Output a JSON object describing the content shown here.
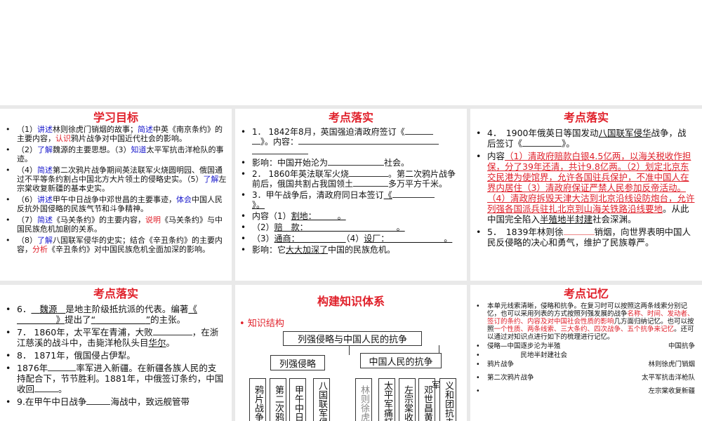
{
  "slides": [
    {
      "title": "学习目标",
      "items": [
        {
          "parts": [
            [
              "",
              "（1）"
            ],
            [
              "blue",
              "讲述"
            ],
            [
              "",
              "林则徐虎门销烟的故事；"
            ],
            [
              "blue",
              "简述"
            ],
            [
              "",
              "中英《南京条约》的主要内容，"
            ],
            [
              "red",
              "认识"
            ],
            [
              "",
              "鸦片战争对中国近代社会的影响。"
            ]
          ]
        },
        {
          "parts": [
            [
              "",
              "（2）"
            ],
            [
              "blue",
              "了解"
            ],
            [
              "",
              "魏源的主要思想。（3）"
            ],
            [
              "blue",
              "知道"
            ],
            [
              "",
              "太平军抗击洋枪队的事迹。"
            ]
          ]
        },
        {
          "parts": [
            [
              "",
              "（4）"
            ],
            [
              "blue",
              "简述"
            ],
            [
              "",
              "第二次鸦片战争期间英法联军火烧圆明园、俄国通过不平等条约割占中国北方大片领土的侵略史实。（5）"
            ],
            [
              "blue",
              "了解"
            ],
            [
              "",
              "左宗棠收复新疆的基本史实。"
            ]
          ]
        },
        {
          "parts": [
            [
              "",
              "（6）"
            ],
            [
              "blue",
              "讲述"
            ],
            [
              "",
              "甲午中日战争中邓世昌的主要事迹，"
            ],
            [
              "blue",
              "体会"
            ],
            [
              "",
              "中国人民反抗外国侵略的民族气节和斗争精神。"
            ]
          ]
        },
        {
          "parts": [
            [
              "",
              "（7）"
            ],
            [
              "blue",
              "简述"
            ],
            [
              "",
              "《马关条约》的主要内容，"
            ],
            [
              "red",
              "说明"
            ],
            [
              "",
              "《马关条约》与中国民族危机加剧的关系。"
            ]
          ]
        },
        {
          "parts": [
            [
              "",
              "（8）"
            ],
            [
              "blue",
              "了解"
            ],
            [
              "",
              "八国联军侵华的史实；结合《辛丑条约》的主要内容，"
            ],
            [
              "red",
              "分析"
            ],
            [
              "",
              "《辛丑条约》对中国民族危机全面加深的影响。"
            ]
          ]
        }
      ]
    },
    {
      "title": "考点落实",
      "items": {
        "i1a": "1． 1842年8月，英国强迫清政府签订《",
        "i1b": "》。内容：",
        "i2": "影响：中国开始沦为",
        "i2b": "社会。",
        "i3a": "2． 1860年英法联军火烧",
        "i3b": "。第二次鸦片战争前后，俄国共割占我国领土",
        "i3c": "多万平方千米。",
        "i4a": "3．甲午战争后，清政府同日本签订",
        "i4b": "《",
        "i4c": "》。",
        "i5a": "内容（1）",
        "i5b": "割地：　　　。",
        "i6a": "（2）",
        "i6b": "赔　款：　　　　　　　　　　　。",
        "i7a": "（3）",
        "i7b": "通商：　　　　　　",
        "i7c": "（4）",
        "i7d": "设厂：　　　　　　　。",
        "i8a": "影响：它",
        "i8b": "大大加深了",
        "i8c": "中国的民族危机。"
      }
    },
    {
      "title": "考点落实",
      "items": {
        "a1": "4．　1900年俄英日等国发动",
        "a2": "八国联军侵华",
        "a3": "战争，战后签订《",
        "a4": "》。",
        "b1": "内容",
        "b2": "（1）清政府赔款白银4.5亿两，以海关税收作担保，分了39年还清，共计9.8亿两。（2）划定北京东交民港为使馆界，允许各国驻兵保护，不准中国人在界内居住（3）清政府保证严禁人民参加反帝活动。（4）清政府拆毁天津大沽到北京沿线设防炮台，允许列强各国派兵驻扎北京到山海关铁路沿线要地",
        "b3": "。从此中国完全陷入",
        "b4": "半殖地半封建",
        "b5": "社会深渊。",
        "c1": "5．　1839年林则徐",
        "c2": "销烟，向世界表明中国人民反侵略的决心和勇气，维护了民族尊严。"
      }
    },
    {
      "title": "考点落实",
      "items": {
        "a1": "6．",
        "a2": "魏源",
        "a3": "是地主阶级抵抗派的代表。编著",
        "a4": "《",
        "a5": "》",
        "a6": "提出了",
        "a7": "“",
        "a8": "”",
        "a9": "的主张。",
        "b1": "7． 1860年，太平军在青浦，大败",
        "b2": "，在浙江慈溪的战斗中，击毙洋枪队头目",
        "b3": "华尔",
        "b4": "。",
        "c1": "8． 1871年，俄国侵占伊犁。",
        "d1": "1876年",
        "d2": "率军进入新疆。在新疆各族人民的支持配合下，节节胜利。1881年，中俄签订条约，中国收回",
        "d3": "。",
        "e1": "9.在甲午中日战争",
        "e2": "海战中，致远舰管带"
      }
    },
    {
      "title": "构建知识体系",
      "subtitle": "知识结构",
      "diagram": {
        "root": "列强侵略与中国人民的抗争",
        "left": "列强侵略",
        "right": "中国人民的抗争",
        "left_items": [
          "鸦片战争",
          "第二次鸦",
          "甲午中日",
          "八国联军侵"
        ],
        "right_items": [
          "林则徐虎",
          "太平军痛打",
          "左宗棠收",
          "邓世昌黄",
          "义和团抗击"
        ],
        "overlap": "军"
      }
    },
    {
      "title": "考点记忆",
      "intro": [
        [
          "",
          "本单元线索清晰，侵略和抗争。在复习时可以按照这两条线索分别记忆，也可以采用列表的方式按照列强发展的战争"
        ],
        [
          "red",
          "名称、时间、发动者、签订的条约、内容及对中国社会性质的影响"
        ],
        [
          "",
          "几方面归纳记忆。也可以按照"
        ],
        [
          "red",
          "一个性质、两条线索、三大条约、四次战争、五个抗争来记忆"
        ],
        [
          "",
          "。还可以通过对知识点进行如下的梳理进行记忆。"
        ]
      ],
      "rows": [
        {
          "left": "侵略—中国逐步沦为半殖",
          "right": "中国抗争"
        },
        {
          "left": "　　　　　民地半封建社会",
          "right": ""
        },
        {
          "left": "鸦片战争",
          "right": "林则徐虎门销烟"
        },
        {
          "left": "第二次鸦片战争",
          "right": "太平军抗击洋枪队"
        },
        {
          "left": "",
          "right": "左宗棠收复新疆"
        }
      ]
    }
  ]
}
